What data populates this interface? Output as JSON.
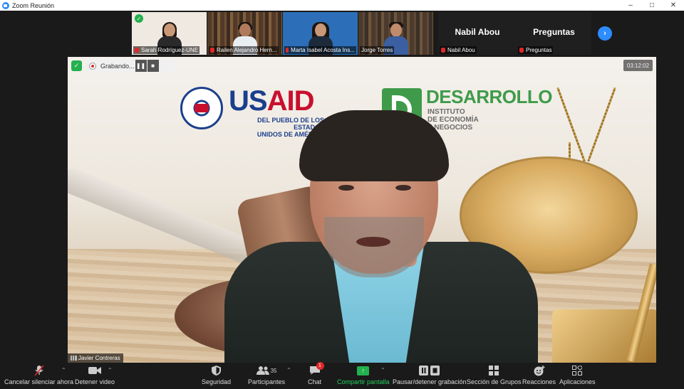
{
  "window": {
    "title": "Zoom Reunión",
    "controls": [
      "–",
      "□",
      "✕"
    ]
  },
  "gallery": {
    "tiles": [
      {
        "name": "Sarah Rodríguez-UNE"
      },
      {
        "name": "Railen Alejandro Hern..."
      },
      {
        "name": "Marta Isabel Acosta Ins..."
      },
      {
        "name": "Jorge Torres"
      },
      {
        "name": "Nabil Abou",
        "display": "Nabil Abou"
      },
      {
        "name": "Preguntas",
        "display": "Preguntas"
      }
    ],
    "next_icon": "chevron-right-icon"
  },
  "recording": {
    "label": "Grabando...",
    "pause_glyph": "❚❚",
    "stop_glyph": "■"
  },
  "timer": "03:12:02",
  "main": {
    "speaker_name": "Javier Contreras",
    "logos": {
      "usaid_us": "US",
      "usaid_aid": "AID",
      "usaid_sub_line1": "DEL PUEBLO DE LOS ESTADOS",
      "usaid_sub_line2": "UNIDOS DE AMÉRICA",
      "des_title": "DESARROLLO",
      "des_sub_line1": "INSTITUTO",
      "des_sub_line2": "DE ECONOMÍA",
      "des_sub_line3": "Y NEGOCIOS"
    }
  },
  "toolbar": {
    "unmute": "Cancelar silenciar ahora",
    "stop_video": "Detener video",
    "security": "Seguridad",
    "participants": "Participantes",
    "participants_count": "35",
    "chat": "Chat",
    "chat_badge": "1",
    "share": "Compartir pantalla",
    "record": "Pausar/detener grabación",
    "groups": "Sección de Grupos",
    "reactions": "Reacciones",
    "apps": "Aplicaciones"
  },
  "colors": {
    "accent": "#2d8cff",
    "share_green": "#23b04e",
    "muted_red": "#e02828"
  }
}
